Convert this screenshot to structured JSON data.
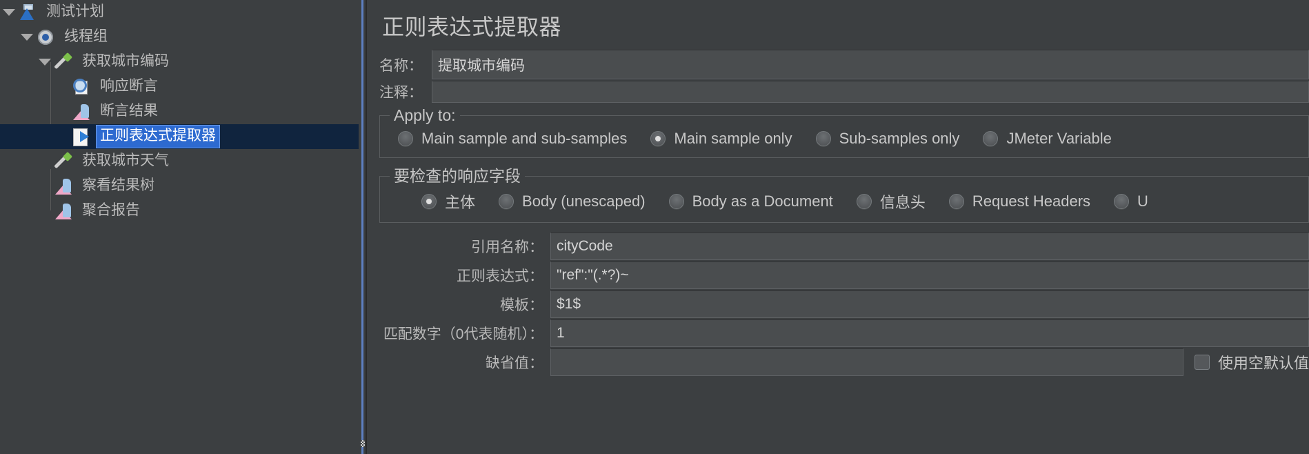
{
  "tree": {
    "items": [
      {
        "label": "测试计划",
        "icon": "flask-icon",
        "depth": 0,
        "expanded": true,
        "selected": false
      },
      {
        "label": "线程组",
        "icon": "gear-icon",
        "depth": 1,
        "expanded": true,
        "selected": false
      },
      {
        "label": "获取城市编码",
        "icon": "pipette-icon",
        "depth": 2,
        "expanded": true,
        "selected": false
      },
      {
        "label": "响应断言",
        "icon": "magnifier-icon",
        "depth": 3,
        "expanded": false,
        "selected": false
      },
      {
        "label": "断言结果",
        "icon": "chart-icon",
        "depth": 3,
        "expanded": false,
        "selected": false
      },
      {
        "label": "正则表达式提取器",
        "icon": "extractor-icon",
        "depth": 3,
        "expanded": false,
        "selected": true
      },
      {
        "label": "获取城市天气",
        "icon": "pipette-icon",
        "depth": 2,
        "expanded": false,
        "selected": false
      },
      {
        "label": "察看结果树",
        "icon": "chart-icon",
        "depth": 2,
        "expanded": false,
        "selected": false
      },
      {
        "label": "聚合报告",
        "icon": "chart-icon",
        "depth": 2,
        "expanded": false,
        "selected": false
      }
    ]
  },
  "panel": {
    "title": "正则表达式提取器",
    "name_label": "名称：",
    "name_value": "提取城市编码",
    "comment_label": "注释：",
    "comment_value": "",
    "apply_to": {
      "title": "Apply to:",
      "options": [
        {
          "label": "Main sample and sub-samples",
          "selected": false
        },
        {
          "label": "Main sample only",
          "selected": true
        },
        {
          "label": "Sub-samples only",
          "selected": false
        },
        {
          "label": "JMeter Variable",
          "selected": false
        }
      ]
    },
    "response_field": {
      "title": "要检查的响应字段",
      "options": [
        {
          "label": "主体",
          "selected": true
        },
        {
          "label": "Body (unescaped)",
          "selected": false
        },
        {
          "label": "Body as a Document",
          "selected": false
        },
        {
          "label": "信息头",
          "selected": false
        },
        {
          "label": "Request Headers",
          "selected": false
        },
        {
          "label": "U",
          "selected": false
        }
      ]
    },
    "fields": [
      {
        "label": "引用名称：",
        "value": "cityCode"
      },
      {
        "label": "正则表达式：",
        "value": "\"ref\":\"(.*?)~"
      },
      {
        "label": "模板：",
        "value": "$1$"
      },
      {
        "label": "匹配数字（0代表随机）：",
        "value": "1"
      }
    ],
    "default_value": {
      "label": "缺省值：",
      "value": "",
      "checkbox_label": "使用空默认值",
      "checked": false
    }
  },
  "colors": {
    "background": "#3c3f41",
    "selection": "#2d6ad0",
    "selection_row": "#10243e",
    "splitter": "#5d7fc0",
    "text": "#c8c8c8",
    "field_bg": "#4a4d4f"
  }
}
